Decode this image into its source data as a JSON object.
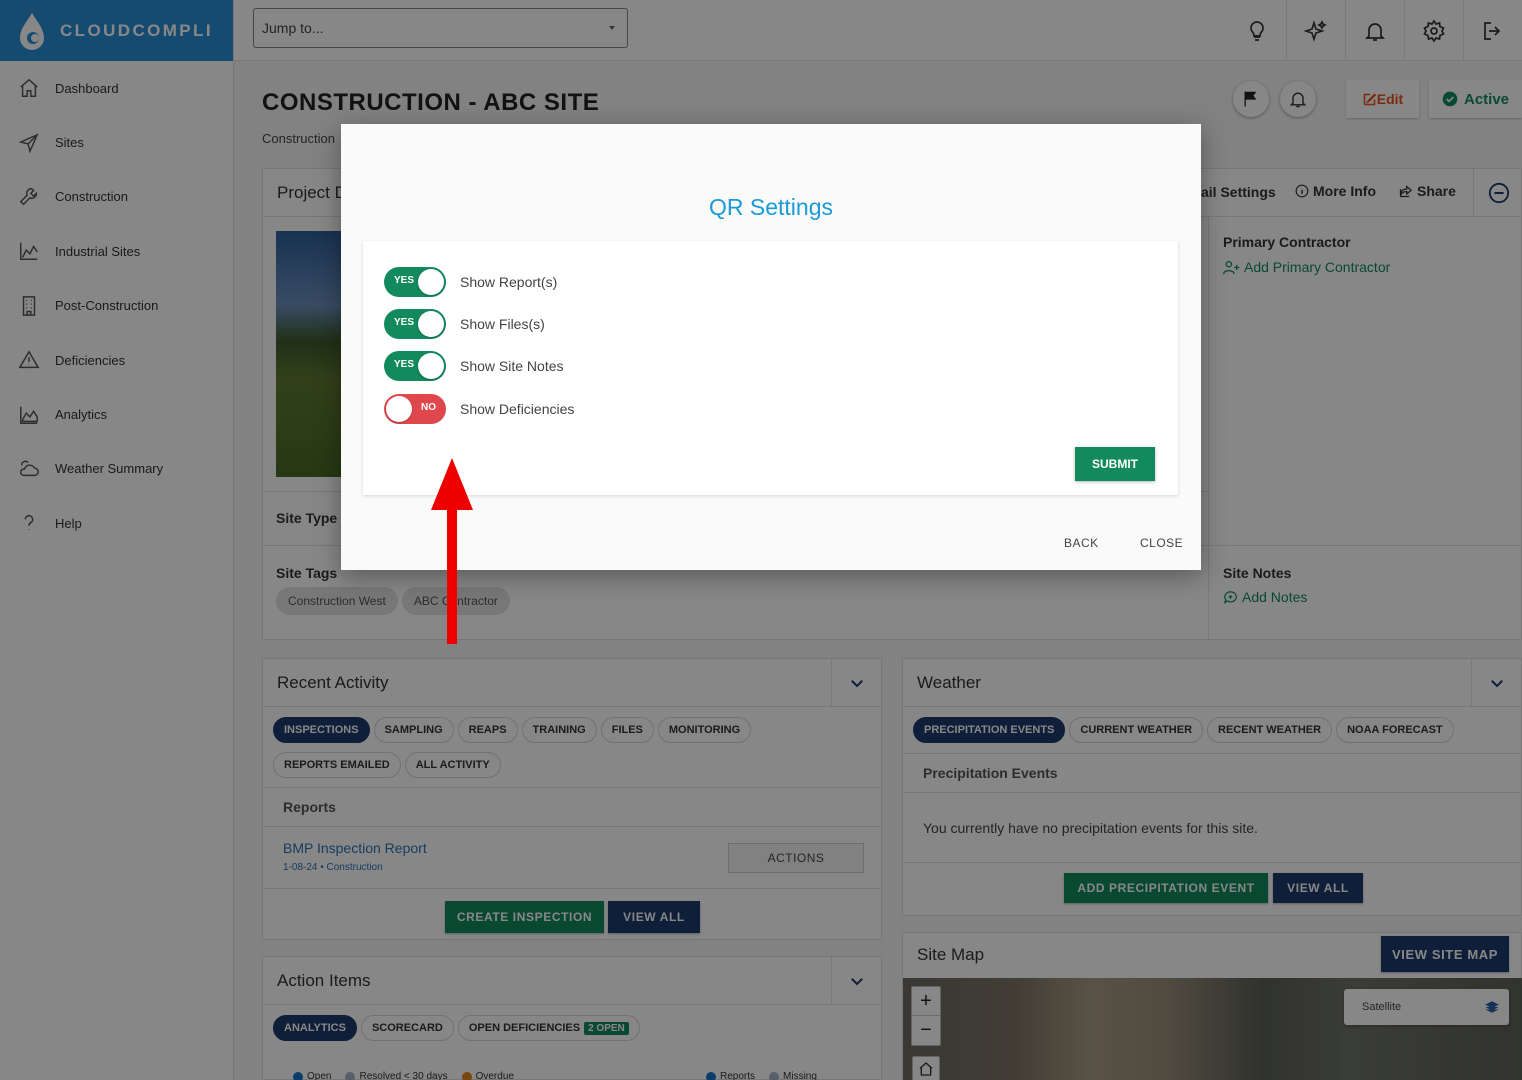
{
  "brand": {
    "name": "CLOUDCOMPLI",
    "color": "#2b8fd6"
  },
  "sidebar": {
    "items": [
      {
        "label": "Dashboard",
        "icon": "home-icon"
      },
      {
        "label": "Sites",
        "icon": "send-icon"
      },
      {
        "label": "Construction",
        "icon": "wrench-icon"
      },
      {
        "label": "Industrial Sites",
        "icon": "factory-icon"
      },
      {
        "label": "Post-Construction",
        "icon": "building-icon"
      },
      {
        "label": "Deficiencies",
        "icon": "warning-icon"
      },
      {
        "label": "Analytics",
        "icon": "chart-icon"
      },
      {
        "label": "Weather Summary",
        "icon": "cloud-sun-icon"
      },
      {
        "label": "Help",
        "icon": "question-icon"
      }
    ]
  },
  "topbar": {
    "jump_placeholder": "Jump to...",
    "icons": [
      "lightbulb-icon",
      "sparkle-icon",
      "bell-icon",
      "gear-icon",
      "logout-icon"
    ]
  },
  "page": {
    "title": "CONSTRUCTION - ABC SITE",
    "breadcrumb": "Construction",
    "edit_label": "Edit",
    "active_label": "Active"
  },
  "project": {
    "title": "Project D",
    "tabs": {
      "settings": "ail Settings",
      "more_info": "More Info",
      "share": "Share"
    },
    "primary_contractor_label": "Primary Contractor",
    "add_primary_contractor": "Add Primary Contractor",
    "site_type_label": "Site Type",
    "site_tags_label": "Site Tags",
    "tags": [
      "Construction West",
      "ABC Contractor"
    ],
    "site_notes_label": "Site Notes",
    "add_notes": "Add Notes"
  },
  "recent_activity": {
    "title": "Recent Activity",
    "tabs": [
      "INSPECTIONS",
      "SAMPLING",
      "REAPS",
      "TRAINING",
      "FILES",
      "MONITORING",
      "REPORTS EMAILED",
      "ALL ACTIVITY"
    ],
    "reports_label": "Reports",
    "report_title": "BMP Inspection Report",
    "report_meta": "1-08-24 • Construction",
    "actions_label": "ACTIONS",
    "create_label": "CREATE INSPECTION",
    "view_all_label": "VIEW ALL"
  },
  "weather": {
    "title": "Weather",
    "tabs": [
      "PRECIPITATION EVENTS",
      "CURRENT WEATHER",
      "RECENT WEATHER",
      "NOAA FORECAST"
    ],
    "section_label": "Precipitation Events",
    "empty_text": "You currently have no precipitation events for this site.",
    "add_label": "ADD PRECIPITATION EVENT",
    "view_all_label": "VIEW ALL"
  },
  "action_items": {
    "title": "Action Items",
    "tabs": [
      "ANALYTICS",
      "SCORECARD",
      "OPEN DEFICIENCIES"
    ],
    "open_badge": "2 OPEN",
    "legend_left": [
      "Open",
      "Resolved < 30 days",
      "Overdue"
    ],
    "legend_right": [
      "Reports",
      "Missing"
    ]
  },
  "site_map": {
    "title": "Site Map",
    "view_label": "VIEW SITE MAP",
    "zoom_in": "+",
    "zoom_out": "−",
    "layer_label": "Satellite"
  },
  "modal": {
    "title": "QR Settings",
    "options": [
      {
        "label": "Show Report(s)",
        "state": "YES"
      },
      {
        "label": "Show Files(s)",
        "state": "YES"
      },
      {
        "label": "Show Site Notes",
        "state": "YES"
      },
      {
        "label": "Show Deficiencies",
        "state": "NO"
      }
    ],
    "submit_label": "SUBMIT",
    "back_label": "BACK",
    "close_label": "CLOSE"
  },
  "colors": {
    "green": "#138a5e",
    "navy": "#1e3a6d",
    "red": "#e0474c",
    "accent_blue": "#1a9ad6",
    "arrow": "#ee0000"
  }
}
